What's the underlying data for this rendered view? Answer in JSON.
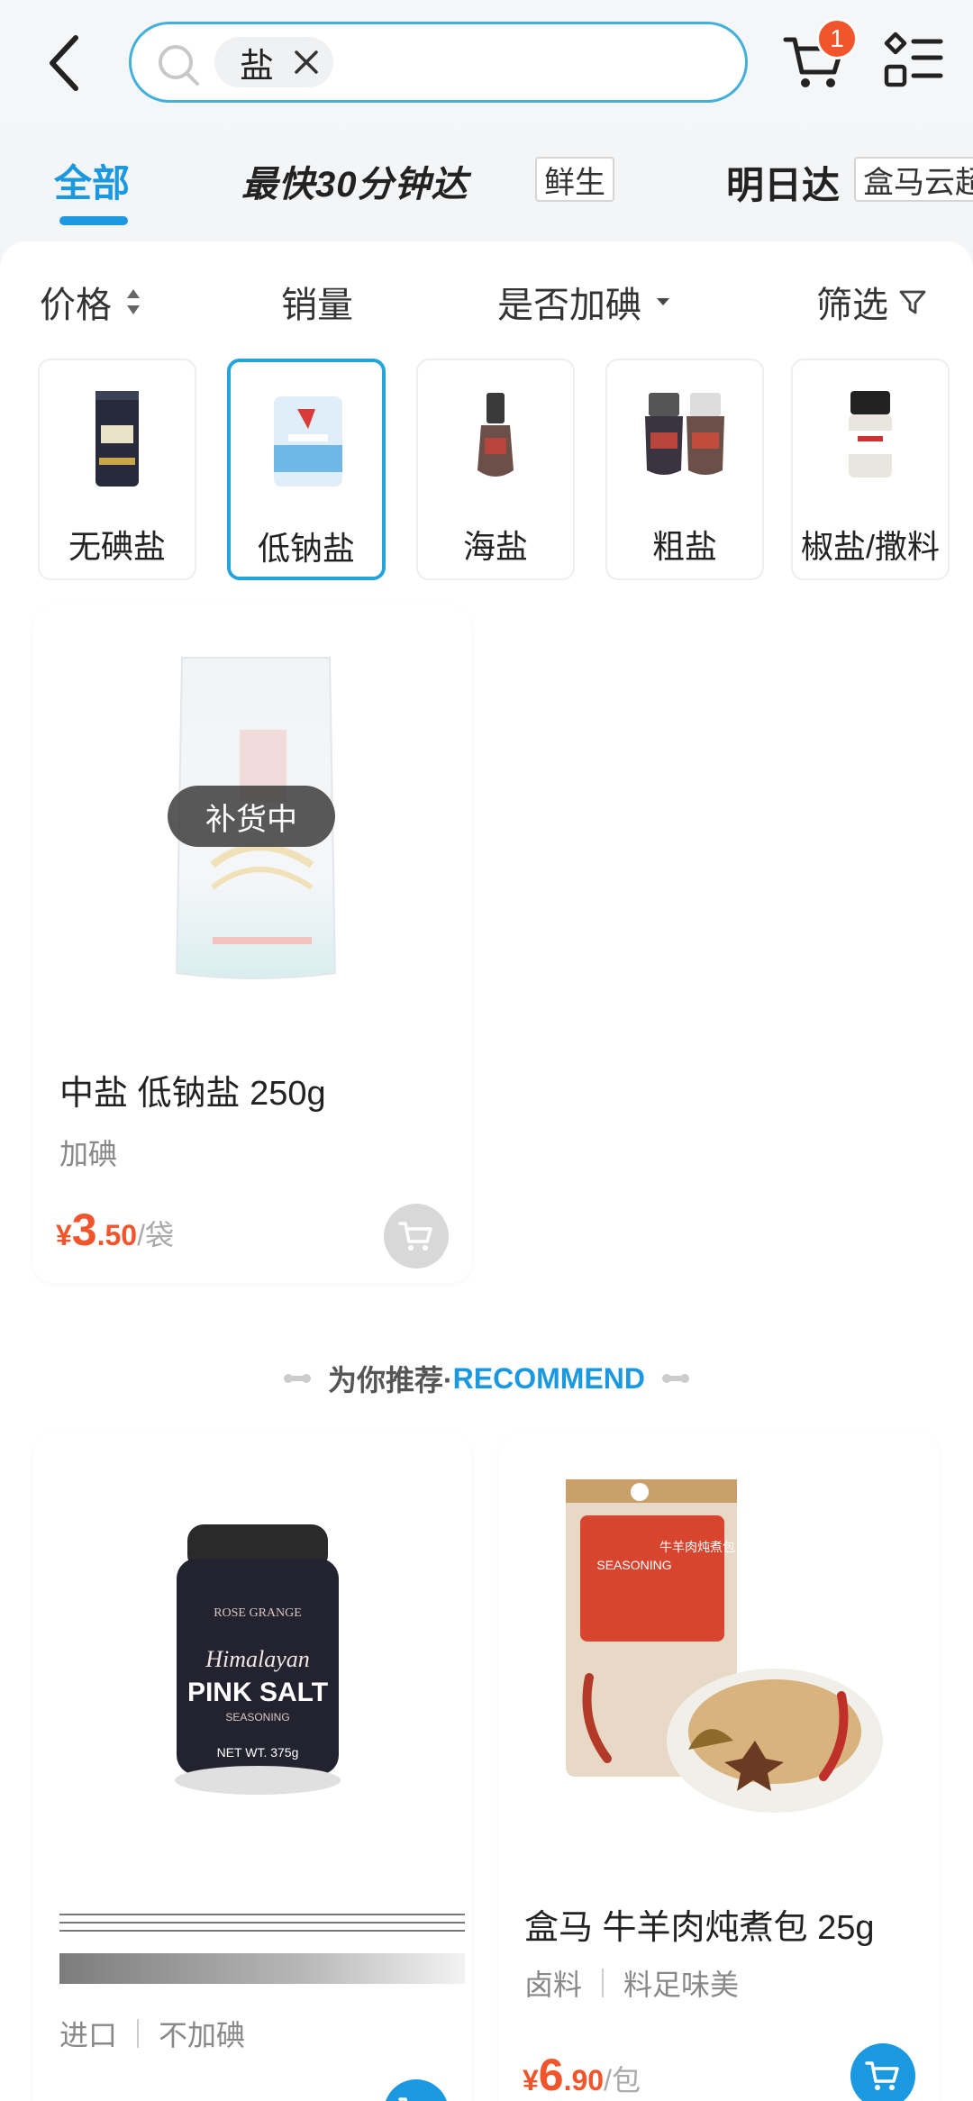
{
  "search": {
    "chip": "盐"
  },
  "cart": {
    "badge": "1"
  },
  "tabs": {
    "all": "全部",
    "fast": "最快30分钟达",
    "fast_tag": "鲜生",
    "tomorrow": "明日达",
    "tomorrow_tag": "盒马云超"
  },
  "sort": {
    "price": "价格",
    "sales": "销量",
    "iodized": "是否加碘",
    "filter": "筛选"
  },
  "categories": [
    {
      "label": "无碘盐",
      "icon": "salt-canister-icon"
    },
    {
      "label": "低钠盐",
      "icon": "salt-bag-icon"
    },
    {
      "label": "海盐",
      "icon": "salt-grinder-icon"
    },
    {
      "label": "粗盐",
      "icon": "salt-grinders-icon"
    },
    {
      "label": "椒盐/撒料",
      "icon": "seasoning-bottle-icon"
    }
  ],
  "product": {
    "title": "中盐 低钠盐 250g",
    "tag": "加碘",
    "status": "补货中",
    "price_currency": "¥",
    "price_int": "3",
    "price_dec": ".50",
    "price_unit": "/袋"
  },
  "recommend": {
    "label_cn": "为你推荐·",
    "label_en": "RECOMMEND"
  },
  "rec_items": [
    {
      "tags": [
        "进口",
        "不加碘"
      ],
      "image_text": "PINK SALT",
      "image_text2": "Himalayan",
      "image_text3": "ROSE GRANGE",
      "image_text4": "SEASONING",
      "image_text5": "NET WT. 375g"
    },
    {
      "title": "盒马 牛羊肉炖煮包 25g",
      "tags": [
        "卤料",
        "料足味美"
      ],
      "price_currency": "¥",
      "price_int": "6",
      "price_dec": ".90",
      "price_unit": "/包",
      "image_text": "牛羊肉炖煮包",
      "image_text2": "SEASONING"
    }
  ],
  "colors": {
    "accent": "#1a98e0",
    "price": "#f2552c",
    "active_border": "#24a4d8"
  }
}
